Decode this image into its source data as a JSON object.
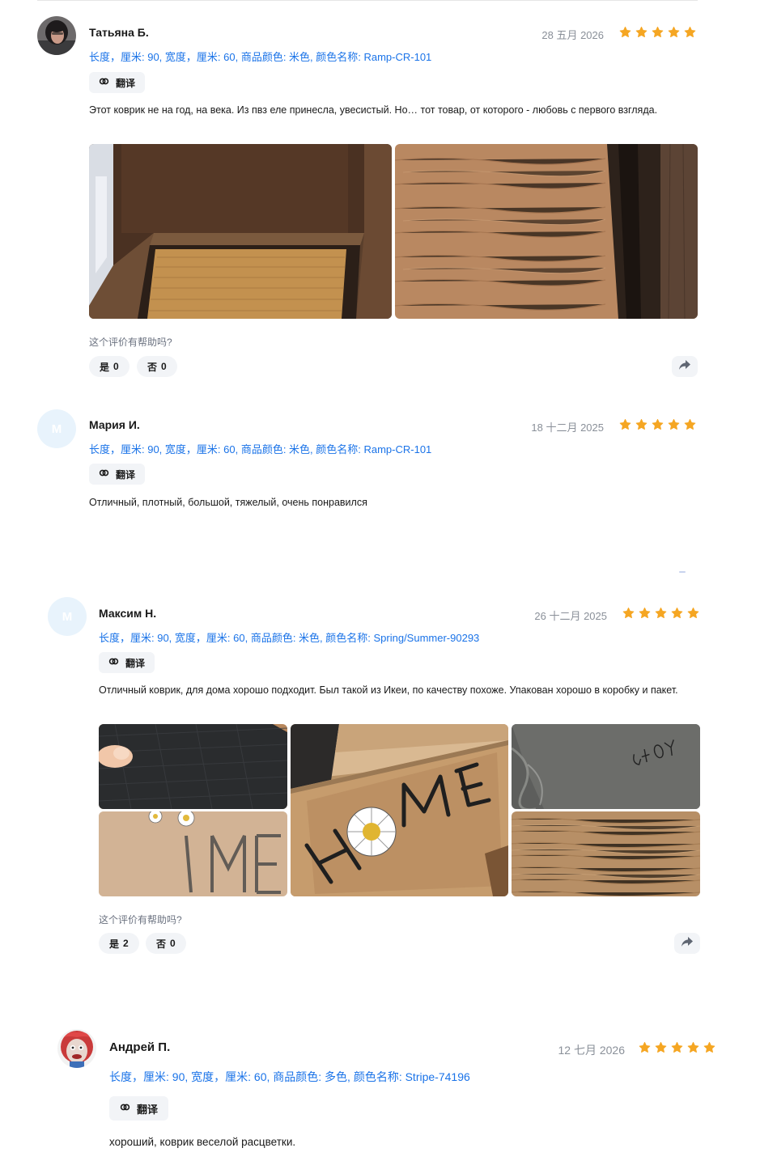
{
  "reviews": [
    {
      "author": "Татьяна Б.",
      "date": "28 五月 2026",
      "rating": 5,
      "spec": "长度，厘米: 90, 宽度，厘米: 60, 商品颜色: 米色, 颜色名称: Ramp-CR-101",
      "translate_label": "翻译",
      "text": "Этот коврик не на год, на века. Из пвз еле принесла, увесистый. Но… тот товар, от которого - любовь с первого взгляда.",
      "helpful_question": "这个评价有帮助吗?",
      "yes_label": "是",
      "yes_count": "0",
      "no_label": "否",
      "no_count": "0"
    },
    {
      "author": "Мария И.",
      "avatar_letter": "M",
      "date": "18 十二月 2025",
      "rating": 5,
      "spec": "长度，厘米: 90, 宽度，厘米: 60, 商品颜色: 米色, 颜色名称: Ramp-CR-101",
      "translate_label": "翻译",
      "text": "Отличный, плотный, большой, тяжелый, очень понравился"
    },
    {
      "author": "Максим Н.",
      "avatar_letter": "M",
      "date": "26 十二月 2025",
      "rating": 5,
      "spec": "长度，厘米: 90, 宽度，厘米: 60, 商品颜色: 米色, 颜色名称: Spring/Summer-90293",
      "translate_label": "翻译",
      "text": "Отличный коврик, для дома хорошо подходит. Был такой из Икеи, по качеству похоже. Упакован хорошо в коробку и пакет.",
      "helpful_question": "这个评价有帮助吗?",
      "yes_label": "是",
      "yes_count": "2",
      "no_label": "否",
      "no_count": "0",
      "photo_texts": {
        "home_h": "H",
        "home_me": "ME",
        "partial_me": "ME",
        "scribble": "G40Y"
      }
    },
    {
      "author": "Андрей П.",
      "date": "12 七月 2026",
      "rating": 5,
      "spec": "长度，厘米: 90, 宽度，厘米: 60, 商品颜色: 多色, 颜色名称: Stripe-74196",
      "translate_label": "翻译",
      "text": "хороший, коврик веселой расцветки."
    }
  ],
  "icons": {
    "star": "star-icon",
    "translate": "translate-icon",
    "share": "share-icon"
  },
  "colors": {
    "star": "#f5a623",
    "spec_link": "#1a73e8",
    "chip_bg": "#f2f4f7",
    "avatar_placeholder": "#e8f3fc"
  }
}
